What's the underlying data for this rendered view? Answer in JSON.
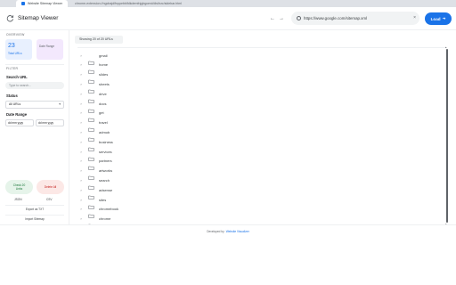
{
  "browser": {
    "tab_title": "Website Sitemap Viewer",
    "url": "chrome-extension://ngcbajdlfnppebblfdkdemfnjgbgomd/dist/src/sidebar.html"
  },
  "header": {
    "title": "Sitemap Viewer",
    "url_value": "https://www.google.com/sitemap.xml",
    "clear_glyph": "×",
    "load_label": "Load",
    "load_glyph": "➜",
    "back_glyph": "←",
    "forward_glyph": "→"
  },
  "sidebar": {
    "overview_label": "OVERVIEW",
    "total_urls_count": "23",
    "total_urls_label": "Total URLs",
    "date_range_label": "Date Range",
    "filter_label": "FILTER",
    "search_label": "Search URL",
    "search_placeholder": "Type to search...",
    "status_label": "Status",
    "status_value": "All URLs",
    "date_range_field_label": "Date Range",
    "date_from": "dd mm yyyy",
    "date_to": "dd mm yyyy",
    "check_label_1": "Check 20",
    "check_label_2": "Links",
    "delete_label": "Delete All",
    "json_label": "JSON",
    "csv_label": "CSV",
    "export_txt_label": "Export as TXT",
    "import_label": "Import Sitemap"
  },
  "main": {
    "showing_label": "Showing 20 of 20 URLs",
    "rows": [
      "gmail",
      "home",
      "slides",
      "sheets",
      "drive",
      "docs",
      "get",
      "travel",
      "admob",
      "business",
      "services",
      "partners",
      "artworks",
      "search",
      "adsense",
      "sites",
      "chromebook",
      "chrome"
    ]
  },
  "footer": {
    "prefix": "Developed by",
    "link": "Website Visualizer"
  },
  "colors": {
    "accent": "#1a73e8",
    "success": "#137333",
    "danger": "#c5221f"
  },
  "icons": {
    "refresh": "refresh-icon",
    "globe": "globe-icon",
    "folder": "folder-icon",
    "caret": "chevron-right-icon"
  }
}
